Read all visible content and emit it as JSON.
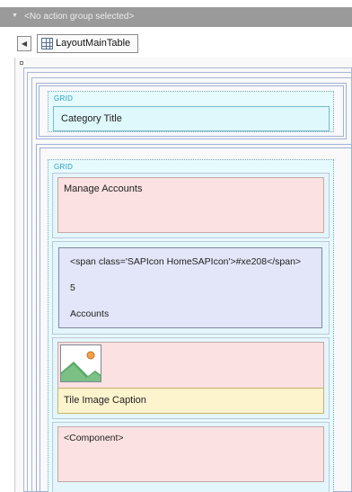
{
  "action_bar": {
    "label": "<No action group selected>"
  },
  "layout_table": {
    "label": "LayoutMainTable"
  },
  "grid_label": "GRID",
  "category_title": "Category Title",
  "manage_accounts": "Manage Accounts",
  "tile": {
    "icon_text": "<span class='SAPIcon HomeSAPIcon'>#xe208</span>",
    "count": "5",
    "label": "Accounts"
  },
  "image_tile": {
    "caption": "Tile Image Caption"
  },
  "component": "<Component>",
  "colors": {
    "action_bar": "#9a9a9a",
    "grid_label": "#26a0c8",
    "grid_bg": "#e6fbfd",
    "pink_cell": "#fbe1e1",
    "tile_bg": "#e2e6f8",
    "caption_bg": "#fdf3cc"
  },
  "icons": [
    "chevron-down-icon",
    "chevron-left-icon",
    "table-icon",
    "image-placeholder-icon"
  ]
}
